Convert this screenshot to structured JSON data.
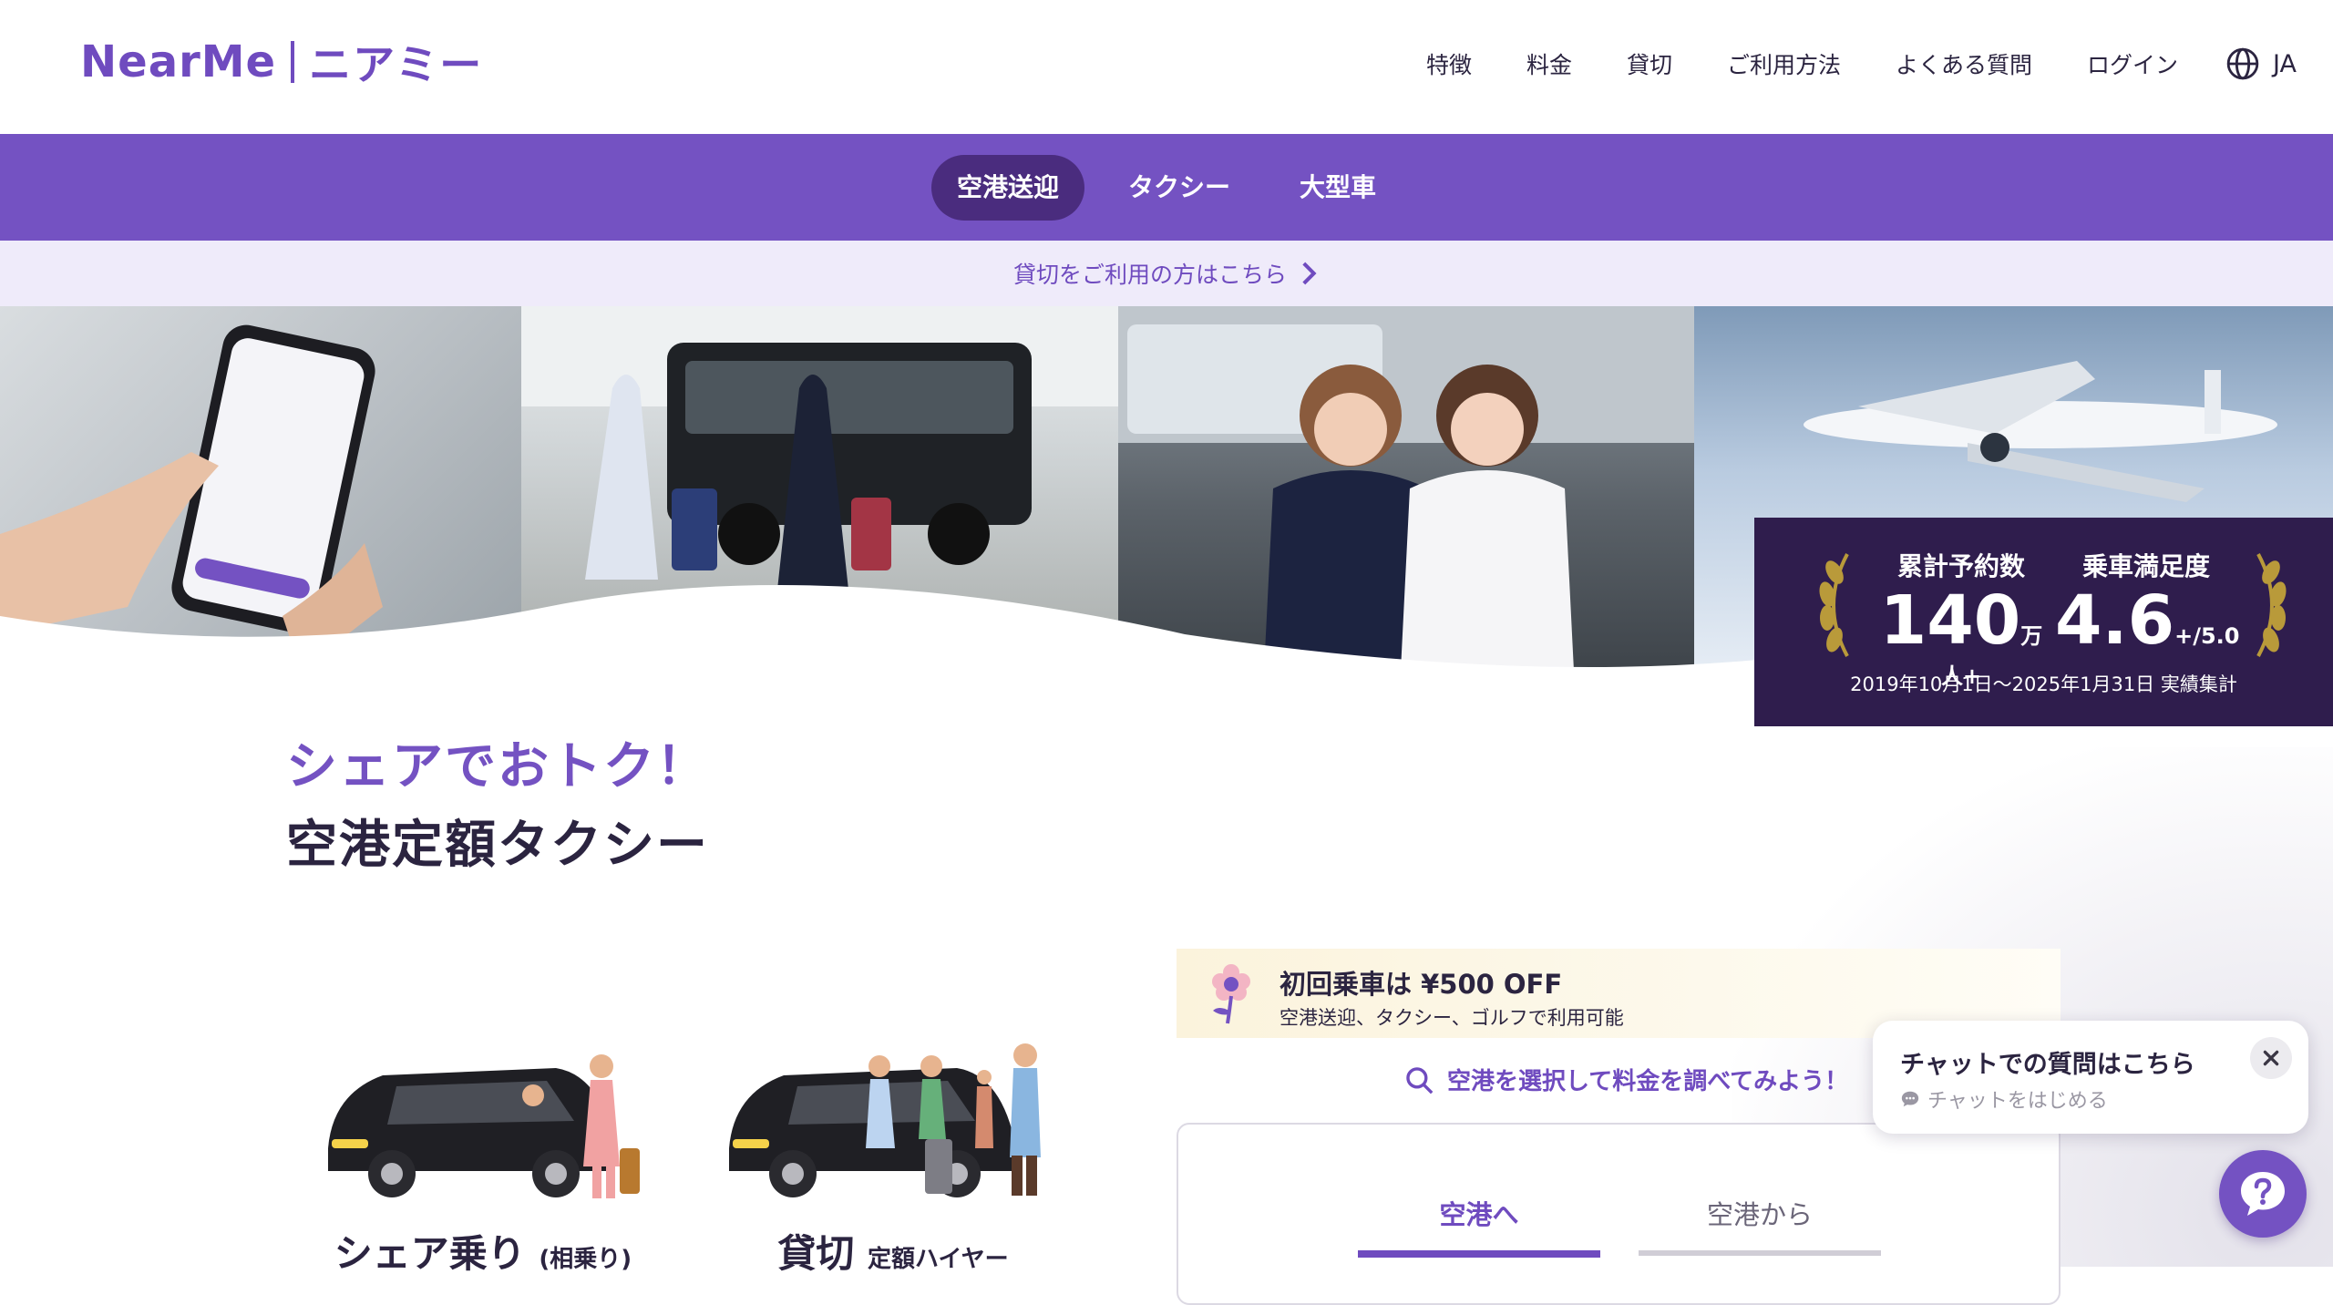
{
  "header": {
    "logo_en": "NearMe",
    "logo_ja": "ニアミー",
    "nav": [
      "特徴",
      "料金",
      "貸切",
      "ご利用方法",
      "よくある質問",
      "ログイン"
    ],
    "language": "JA"
  },
  "category_tabs": [
    "空港送迎",
    "タクシー",
    "大型車"
  ],
  "charter_link": "貸切をご利用の方はこちら",
  "stats": {
    "reservations_label": "累計予約数",
    "reservations_value": "140",
    "reservations_unit": "万人+",
    "satisfaction_label": "乗車満足度",
    "satisfaction_value": "4.6",
    "satisfaction_unit": "+/5.0",
    "note": "2019年10月1日〜2025年1月31日 実績集計"
  },
  "headline": {
    "line1": "シェアでおトク！",
    "line2": "空港定額タクシー"
  },
  "services": [
    {
      "title": "シェア乗り",
      "sub": "(相乗り)"
    },
    {
      "title": "貸切",
      "sub": "定額ハイヤー"
    }
  ],
  "promo": {
    "title": "初回乗車は ¥500 OFF",
    "subtitle": "空港送迎、タクシー、ゴルフで利用可能"
  },
  "search_hint": "空港を選択して料金を調べてみよう！",
  "booking_tabs": [
    "空港へ",
    "空港から"
  ],
  "chat": {
    "title": "チャットでの質問はこちら",
    "subtitle": "チャットをはじめる"
  },
  "colors": {
    "brand_purple": "#7452c2",
    "dark_purple": "#2f1d4d",
    "gold": "#b99a3a"
  }
}
